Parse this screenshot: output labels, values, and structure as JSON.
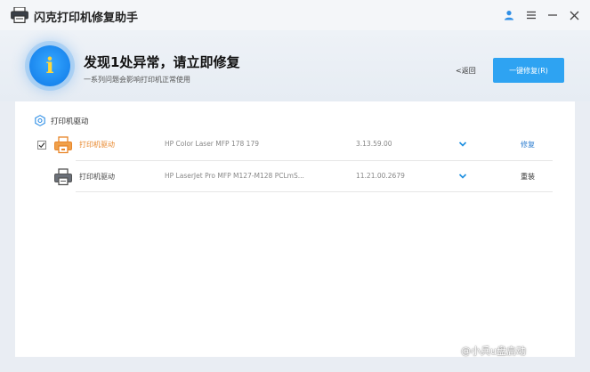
{
  "window": {
    "title": "闪克打印机修复助手"
  },
  "header": {
    "headline": "发现1处异常，请立即修复",
    "subline": "一系列问题会影响打印机正常使用",
    "back_label": "<返回",
    "fix_all_label": "一键修复(R)",
    "alert_glyph": "i"
  },
  "section": {
    "title": "打印机驱动"
  },
  "rows": [
    {
      "checked": true,
      "name": "打印机驱动",
      "model": "HP Color Laser MFP 178 179",
      "version": "3.13.59.00",
      "action": "修复",
      "status_color": "#e8862a"
    },
    {
      "checked": false,
      "name": "打印机驱动",
      "model": "HP LaserJet Pro MFP M127-M128 PCLmS...",
      "version": "11.21.00.2679",
      "action": "重装",
      "status_color": "#555555"
    }
  ],
  "watermark": {
    "text": "@小兵u盘启动"
  },
  "colors": {
    "accent": "#2ea3f2",
    "warning": "#e8862a",
    "link": "#2f7fd0",
    "chevron": "#1e8fe0"
  }
}
